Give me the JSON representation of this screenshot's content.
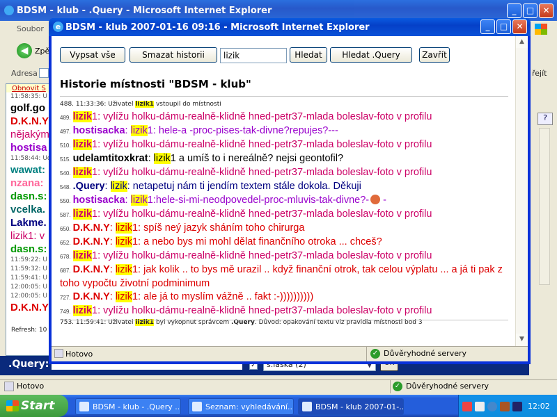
{
  "bg_window": {
    "title": "BDSM - klub - .Query - Microsoft Internet Explorer",
    "menu_first": "Soubor",
    "back_label": "Zpě",
    "address_label": "Adresa",
    "go_label": "řejít",
    "chat_head": "Obnovit S",
    "chat_lines": [
      {
        "ts": "11:58:35: U"
      },
      {
        "text": "golf.go",
        "color": "#000000"
      },
      {
        "text": "D.K.N.Y",
        "color": "#dd0000"
      },
      {
        "text": "nějakým",
        "color": "#cc0066",
        "light": true
      },
      {
        "text": "hostisa",
        "color": "#9900cc"
      },
      {
        "ts": "11:58:44: Ud"
      },
      {
        "text": "wawat:",
        "color": "#008080"
      },
      {
        "text": "nzana:",
        "color": "#ff6699"
      },
      {
        "text": "dasn.s:",
        "color": "#009900"
      },
      {
        "text": "vcelka.",
        "color": "#006666"
      },
      {
        "text": "Lakme.",
        "color": "#000080"
      },
      {
        "text": "lizik1: v",
        "color": "#cc0066",
        "light": true
      },
      {
        "text": "dasn.s:",
        "color": "#009900"
      },
      {
        "ts": "11:59:22: U"
      },
      {
        "ts": "11:59:32: U"
      },
      {
        "ts": "11:59:41: U"
      },
      {
        "ts": "12:00:05: U"
      },
      {
        "ts": "12:00:05: U"
      },
      {
        "text": "D.K.N.Y",
        "color": "#dd0000"
      }
    ],
    "refresh_label": "Refresh: 10",
    "query_label": ".Query:",
    "select_value": "s.laska (2)",
    "ok_label": "OK",
    "status": "Hotovo",
    "trust": "Důvěryhodné servery"
  },
  "popup": {
    "title": "BDSM - klub 2007-01-16 09:16 - Microsoft Internet Explorer",
    "buttons": {
      "show_all": "Vypsat vše",
      "clear_history": "Smazat historii",
      "search": "Hledat",
      "search_query": "Hledat .Query",
      "close": "Zavřít"
    },
    "search_value": "lizik",
    "heading": "Historie místnosti \"BDSM - klub\"",
    "log": [
      {
        "type": "sys",
        "num": "488.",
        "pre": "11:33:36: Uživatel ",
        "hl": "lizik1",
        "post": " vstoupil do místnosti"
      },
      {
        "type": "msg",
        "num": "489.",
        "user": "lizik",
        "user_suffix": "1",
        "user_color": "#cc0066",
        "user_hl": true,
        "sep": ": ",
        "text": "vylížu holku-dámu-realně-klidně hned-petr37-mlada boleslav-foto v profilu",
        "color": "#cc0066"
      },
      {
        "type": "msg",
        "num": "497.",
        "user": "hostisacka",
        "user_color": "#9900cc",
        "sep": ": ",
        "mention": "lizik",
        "mention_suffix": "1: hele-a -proc-pises-tak-divne?repujes?---",
        "color": "#9900cc"
      },
      {
        "type": "msg",
        "num": "510.",
        "user": "lizik",
        "user_suffix": "1",
        "user_color": "#cc0066",
        "user_hl": true,
        "sep": ": ",
        "text": "vylížu holku-dámu-realně-klidně hned-petr37-mlada boleslav-foto v profilu",
        "color": "#cc0066"
      },
      {
        "type": "msg",
        "num": "515.",
        "user": "udelamtitoxkrat",
        "user_color": "#000000",
        "sep": ": ",
        "mention": "lizik",
        "mention_suffix": "1 a umíš to i nereálně? nejsi geontofil?",
        "color": "#000000"
      },
      {
        "type": "msg",
        "num": "540.",
        "user": "lizik",
        "user_suffix": "1",
        "user_color": "#cc0066",
        "user_hl": true,
        "sep": ": ",
        "text": "vylížu holku-dámu-realně-klidně hned-petr37-mlada boleslav-foto v profilu",
        "color": "#cc0066"
      },
      {
        "type": "msg",
        "num": "548.",
        "user": ".Query",
        "user_color": "#000080",
        "sep": ": ",
        "mention": "lizik",
        "mention_suffix": ": netapetuj nám ti jendím textem stále dokola. Děkuji",
        "color": "#000080"
      },
      {
        "type": "msg",
        "num": "550.",
        "user": "hostisacka",
        "user_color": "#9900cc",
        "sep": ": ",
        "mention": "lizik",
        "mention_suffix": "1:hele-si-mi-neodpovedel-proc-mluvis-tak-divne?-",
        "trail": " -",
        "smiley": true,
        "color": "#9900cc"
      },
      {
        "type": "msg",
        "num": "587.",
        "user": "lizik",
        "user_suffix": "1",
        "user_color": "#cc0066",
        "user_hl": true,
        "sep": ": ",
        "text": "vylížu holku-dámu-realně-klidně hned-petr37-mlada boleslav-foto v profilu",
        "color": "#cc0066"
      },
      {
        "type": "msg",
        "num": "650.",
        "user": "D.K.N.Y",
        "user_color": "#dd0000",
        "sep": ": ",
        "mention": "lizik",
        "mention_suffix": "1: spíš neý jazyk sháním toho chirurga",
        "color": "#dd0000"
      },
      {
        "type": "msg",
        "num": "652.",
        "user": "D.K.N.Y",
        "user_color": "#dd0000",
        "sep": ": ",
        "mention": "lizik",
        "mention_suffix": "1: a nebo bys mi mohl dělat finančního otroka ... chceš?",
        "color": "#dd0000"
      },
      {
        "type": "msg",
        "num": "678.",
        "user": "lizik",
        "user_suffix": "1",
        "user_color": "#cc0066",
        "user_hl": true,
        "sep": ": ",
        "text": "vylížu holku-dámu-realně-klidně hned-petr37-mlada boleslav-foto v profilu",
        "color": "#cc0066"
      },
      {
        "type": "msg",
        "num": "687.",
        "user": "D.K.N.Y",
        "user_color": "#dd0000",
        "sep": ": ",
        "mention": "lizik",
        "mention_suffix": "1: jak kolik .. to bys mě urazil .. když finanční otrok, tak celou výplatu ... a já ti pak z toho vypočtu životní podminimum",
        "color": "#dd0000",
        "wrap": true
      },
      {
        "type": "msg",
        "num": "727.",
        "user": "D.K.N.Y",
        "user_color": "#dd0000",
        "sep": ": ",
        "mention": "lizik",
        "mention_suffix": "1: ale já to myslím vážně .. fakt :-))))))))))",
        "color": "#dd0000"
      },
      {
        "type": "msg",
        "num": "749.",
        "user": "lizik",
        "user_suffix": "1",
        "user_color": "#cc0066",
        "user_hl": true,
        "sep": ": ",
        "text": "vylížu holku-dámu-realně-klidně hned-petr37-mlada boleslav-foto v profilu",
        "color": "#cc0066"
      },
      {
        "type": "sys",
        "num": "753.",
        "pre": "11:59:41: Uživatel ",
        "hl": "lizik1",
        "post": " byl vykopnut správcem ",
        "strong": ".Query",
        "post2": ". Důvod: opakování textu viz pravidla místnosti bod 3"
      }
    ],
    "status": "Hotovo",
    "trust": "Důvěryhodné servery"
  },
  "taskbar": {
    "start": "Start",
    "tasks": [
      {
        "label": "BDSM - klub - .Query ...",
        "active": false
      },
      {
        "label": "Seznam: vyhledávání...",
        "active": false
      },
      {
        "label": "BDSM - klub 2007-01-...",
        "active": true
      }
    ],
    "clock": "12:02"
  },
  "colors": {
    "title_blue": "#0a52d8",
    "highlight": "#ffff00",
    "magenta_user": "#cc0066",
    "purple_user": "#9900cc",
    "red_user": "#dd0000"
  }
}
